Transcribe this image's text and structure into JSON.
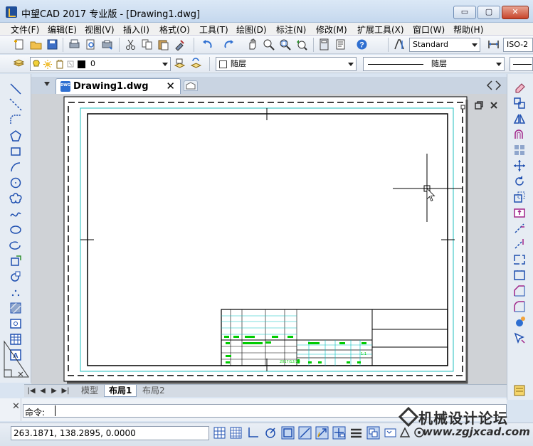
{
  "window": {
    "title": "中望CAD 2017 专业版 - [Drawing1.dwg]",
    "minimize_glyph": "▭",
    "maximize_glyph": "▢",
    "close_glyph": "✕"
  },
  "menu": [
    "文件(F)",
    "编辑(E)",
    "视图(V)",
    "插入(I)",
    "格式(O)",
    "工具(T)",
    "绘图(D)",
    "标注(N)",
    "修改(M)",
    "扩展工具(X)",
    "窗口(W)",
    "帮助(H)"
  ],
  "toolbar": {
    "text_style": "Standard",
    "dim_style": "ISO-2",
    "layer_name": "0",
    "layer_color_value": "随层",
    "linetype_value": "随层"
  },
  "document": {
    "tab_label": "Drawing1.dwg",
    "tab_close": "✕",
    "tab_icon_text": "DWG"
  },
  "title_block": {
    "date_a": "2017/12/28",
    "scale": "1:1"
  },
  "layout_tabs": [
    "模型",
    "布局1",
    "布局2"
  ],
  "active_layout": "布局1",
  "command": {
    "prompt": "命令:",
    "value": ""
  },
  "status": {
    "coordinates": "263.1871, 138.2895, 0.0000"
  },
  "watermark": {
    "cn": "机械设计论坛",
    "url": "www.zgjxcad.com"
  },
  "colors": {
    "accent": "#2e6fd1",
    "titleblock_text": "#00cc00",
    "titleblock_line": "#00c0c0",
    "viewport_line": "#22bfbf"
  }
}
